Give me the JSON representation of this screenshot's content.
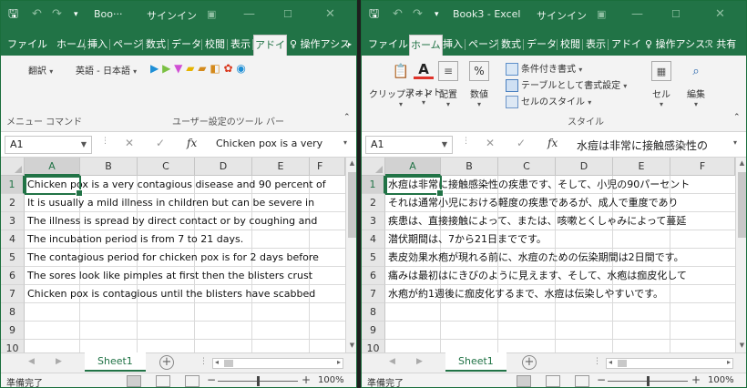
{
  "left": {
    "title": "Boo···",
    "signin": "サインイン",
    "tabs": [
      "ファイル",
      "ホーム",
      "挿入",
      "ページ",
      "数式",
      "データ",
      "校閲",
      "表示",
      "アドイ"
    ],
    "tell_me": "操作アシス",
    "ribbon": {
      "translate": "翻訳",
      "language_pair": "英語 - 日本語",
      "group_left": "メニュー コマンド",
      "group_right": "ユーザー設定のツール バー"
    },
    "name_box": "A1",
    "formula": "Chicken pox is a very",
    "columns": [
      "A",
      "B",
      "C",
      "D",
      "E",
      "F"
    ],
    "row_numbers": [
      "1",
      "2",
      "3",
      "4",
      "5",
      "6",
      "7",
      "8",
      "9",
      "10"
    ],
    "rows": [
      "Chicken pox is a very contagious disease and 90 percent of",
      "It is usually a mild illness in children but can be severe in",
      "The illness is spread by direct contact or by coughing and",
      "The incubation period is from 7 to 21 days.",
      "The contagious period for chicken pox is for 2 days before",
      "The sores look like pimples at first then the blisters crust",
      "Chicken pox is contagious until the blisters have scabbed",
      "",
      "",
      ""
    ],
    "sheet": "Sheet1",
    "status": "準備完了",
    "zoom": "100%"
  },
  "right": {
    "title": "Book3 - Excel",
    "signin": "サインイン",
    "tabs": [
      "ファイル",
      "ホーム",
      "挿入",
      "ページ",
      "数式",
      "データ",
      "校閲",
      "表示",
      "アドイ"
    ],
    "tell_me": "操作アシス",
    "share": "共有",
    "ribbon": {
      "clipboard": "クリップボード",
      "font": "フォント",
      "alignment": "配置",
      "number": "数値",
      "cond_format": "条件付き書式",
      "format_table": "テーブルとして書式設定",
      "cell_styles": "セルのスタイル",
      "styles_group": "スタイル",
      "cells": "セル",
      "editing": "編集"
    },
    "name_box": "A1",
    "formula": "水痘は非常に接触感染性の",
    "columns": [
      "A",
      "B",
      "C",
      "D",
      "E",
      "F"
    ],
    "row_numbers": [
      "1",
      "2",
      "3",
      "4",
      "5",
      "6",
      "7",
      "8",
      "9",
      "10"
    ],
    "rows": [
      "水痘は非常に接触感染性の疾患です、そして、小児の90パーセント",
      "それは通常小児における軽度の疾患であるが、成人で重度であり",
      "疾患は、直接接触によって、または、咳嗽とくしゃみによって蔓延",
      "潜伏期間は、7から21日までです。",
      "表皮効果水疱が現れる前に、水痘のための伝染期間は2日間です。",
      "痛みは最初はにきびのように見えます、そして、水疱は痂皮化して",
      "水疱が約1週後に痂皮化するまで、水痘は伝染しやすいです。",
      "",
      "",
      ""
    ],
    "sheet": "Sheet1",
    "status": "準備完了",
    "zoom": "100%"
  },
  "colors": {
    "excel_green": "#217346",
    "ribbon_bg": "#f3f3f3",
    "header_bg": "#e6e6e6",
    "add_in_icons": [
      "#1e8fd6",
      "#7bc043",
      "#d04fd4",
      "#e6b400",
      "#d48a1c",
      "#d9361b",
      "#1e8fd6"
    ]
  }
}
